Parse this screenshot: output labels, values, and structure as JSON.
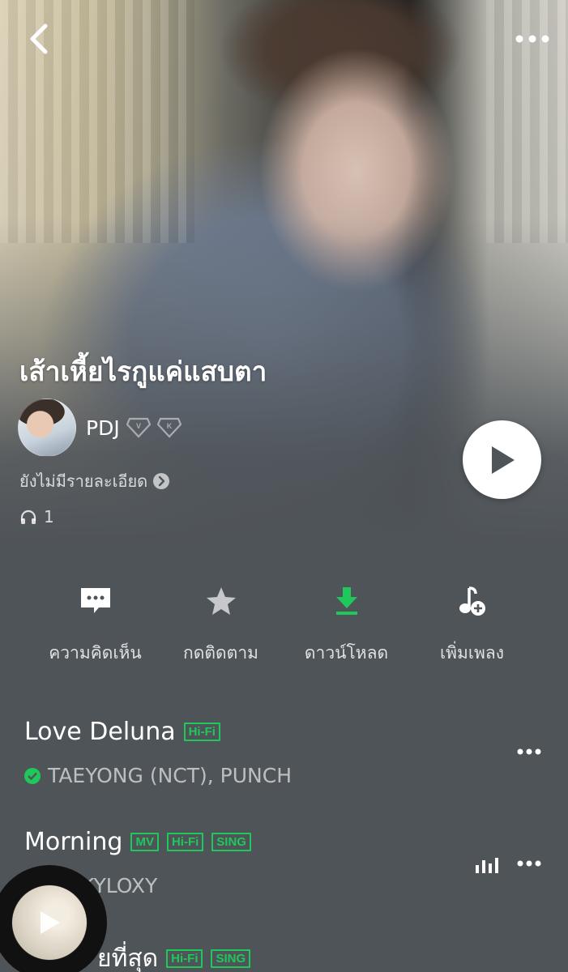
{
  "header": {
    "back_icon": "chevron-left-icon",
    "more_icon": "ellipsis-icon"
  },
  "album": {
    "title": "เส้าเหี้ยไรกูแค่แสบตา",
    "owner_name": "PDJ",
    "badges": [
      "diamond-v-badge-icon",
      "diamond-k-badge-icon"
    ],
    "description": "ยังไม่มีรายละเอียด",
    "listen_count": "1"
  },
  "actions": [
    {
      "label": "ความคิดเห็น",
      "icon": "comment-icon"
    },
    {
      "label": "กดติดตาม",
      "icon": "star-icon"
    },
    {
      "label": "ดาวน์โหลด",
      "icon": "download-icon",
      "color": "#1fc85a"
    },
    {
      "label": "เพิ่มเพลง",
      "icon": "add-music-icon"
    }
  ],
  "songs": [
    {
      "title": "Love Deluna",
      "tags": [
        "Hi-Fi"
      ],
      "artist": "TAEYONG (NCT), PUNCH",
      "verified": true
    },
    {
      "title": "Morning",
      "tags": [
        "MV",
        "Hi-Fi",
        "SING"
      ],
      "artist": "KYLOXY",
      "playing": true
    },
    {
      "title": "ยที่สุด",
      "tags": [
        "Hi-Fi",
        "SING"
      ],
      "artist": ""
    }
  ],
  "colors": {
    "accent": "#1fc85a",
    "background": "#4f5459"
  }
}
